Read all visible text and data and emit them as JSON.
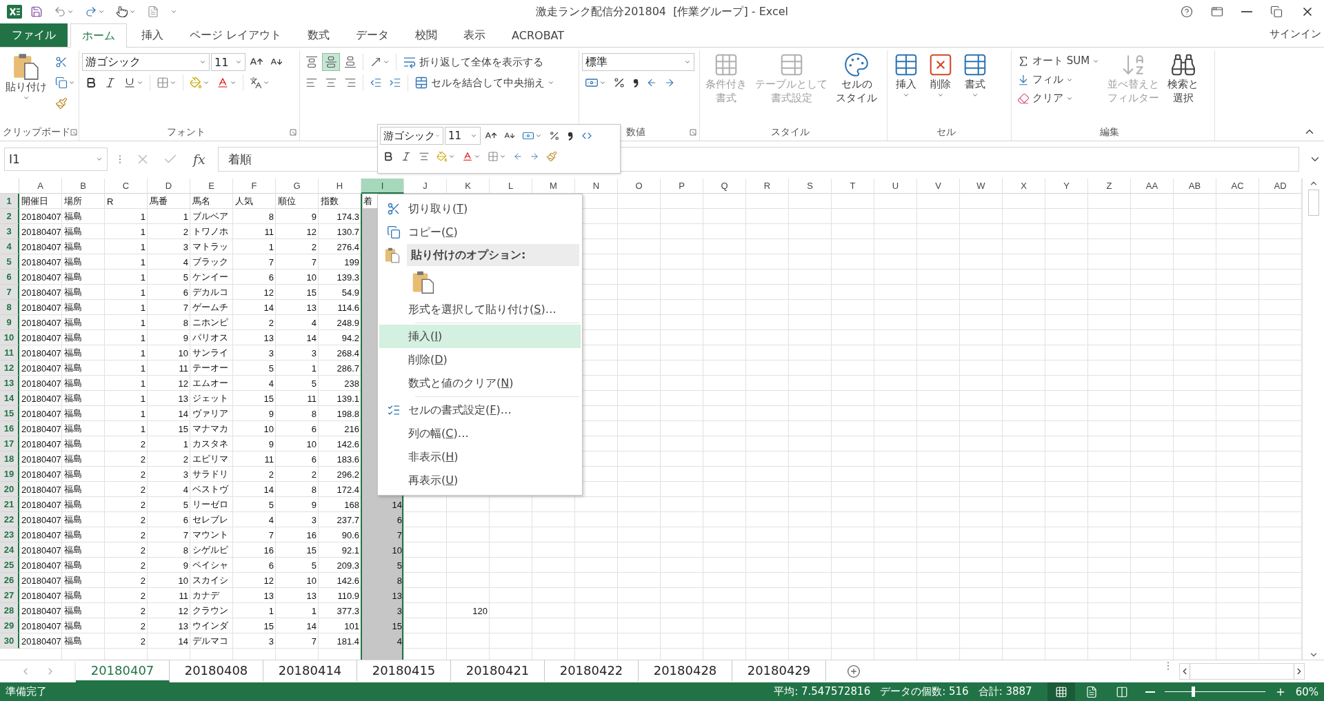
{
  "title_bar": {
    "title": "激走ランク配信分201804  [作業グループ] - Excel"
  },
  "ribbon_tabs": [
    {
      "label": "ファイル",
      "kind": "file",
      "selected": false
    },
    {
      "label": "ホーム",
      "kind": "tab",
      "selected": true
    },
    {
      "label": "挿入",
      "kind": "tab",
      "selected": false
    },
    {
      "label": "ページ レイアウト",
      "kind": "tab",
      "selected": false
    },
    {
      "label": "数式",
      "kind": "tab",
      "selected": false
    },
    {
      "label": "データ",
      "kind": "tab",
      "selected": false
    },
    {
      "label": "校閲",
      "kind": "tab",
      "selected": false
    },
    {
      "label": "表示",
      "kind": "tab",
      "selected": false
    },
    {
      "label": "ACROBAT",
      "kind": "tab",
      "selected": false
    }
  ],
  "sign_in": "サインイン",
  "ribbon": {
    "clipboard": {
      "paste": "貼り付け",
      "label": "クリップボード"
    },
    "font": {
      "face": "游ゴシック",
      "size": "11",
      "label": "フォント"
    },
    "alignment": {
      "vertical": [
        {
          "selected": false
        },
        {
          "selected": true
        },
        {
          "selected": false
        }
      ],
      "wrap": "折り返して全体を表示する",
      "merge": "セルを結合して中央揃え"
    },
    "number": {
      "format": "標準",
      "label": "数値"
    },
    "styles": {
      "buttons": [
        {
          "lines": [
            "条件付き",
            "書式"
          ],
          "disabled": true
        },
        {
          "lines": [
            "テーブルとして",
            "書式設定"
          ],
          "disabled": true
        },
        {
          "lines": [
            "セルの",
            "スタイル"
          ],
          "disabled": false
        }
      ],
      "label": "スタイル"
    },
    "cells": {
      "buttons": [
        {
          "label": "挿入"
        },
        {
          "label": "削除"
        },
        {
          "label": "書式"
        }
      ],
      "label": "セル"
    },
    "editing": {
      "autosum": "オート SUM",
      "fill": "フィル",
      "clear": "クリア",
      "buttons": [
        {
          "lines": [
            "並べ替えと",
            "フィルター"
          ],
          "disabled": true
        },
        {
          "lines": [
            "検索と",
            "選択"
          ],
          "disabled": false
        }
      ],
      "label": "編集"
    }
  },
  "formula_bar": {
    "name_box": "I1",
    "function_label": "fx",
    "value": "着順"
  },
  "mini_toolbar": {
    "font": "游ゴシック",
    "size": "11"
  },
  "columns": [
    {
      "label": "A",
      "kind": "text",
      "selected": false
    },
    {
      "label": "B",
      "kind": "text",
      "selected": false
    },
    {
      "label": "C",
      "kind": "number",
      "selected": false
    },
    {
      "label": "D",
      "kind": "number",
      "selected": false
    },
    {
      "label": "E",
      "kind": "text",
      "selected": false
    },
    {
      "label": "F",
      "kind": "number",
      "selected": false
    },
    {
      "label": "G",
      "kind": "number",
      "selected": false
    },
    {
      "label": "H",
      "kind": "number",
      "selected": false
    },
    {
      "label": "I",
      "kind": "number",
      "selected": true
    },
    {
      "label": "J",
      "kind": "number",
      "selected": false
    },
    {
      "label": "K",
      "kind": "number",
      "selected": false
    },
    {
      "label": "L",
      "kind": "number",
      "selected": false
    },
    {
      "label": "M",
      "kind": "number",
      "selected": false
    },
    {
      "label": "N",
      "kind": "number",
      "selected": false
    },
    {
      "label": "O",
      "kind": "number",
      "selected": false
    },
    {
      "label": "P",
      "kind": "number",
      "selected": false
    },
    {
      "label": "Q",
      "kind": "number",
      "selected": false
    },
    {
      "label": "R",
      "kind": "number",
      "selected": false
    },
    {
      "label": "S",
      "kind": "number",
      "selected": false
    },
    {
      "label": "T",
      "kind": "number",
      "selected": false
    },
    {
      "label": "U",
      "kind": "number",
      "selected": false
    },
    {
      "label": "V",
      "kind": "number",
      "selected": false
    },
    {
      "label": "W",
      "kind": "number",
      "selected": false
    },
    {
      "label": "X",
      "kind": "number",
      "selected": false
    },
    {
      "label": "Y",
      "kind": "number",
      "selected": false
    },
    {
      "label": "Z",
      "kind": "number",
      "selected": false
    },
    {
      "label": "AA",
      "kind": "number",
      "selected": false
    },
    {
      "label": "AB",
      "kind": "number",
      "selected": false
    },
    {
      "label": "AC",
      "kind": "number",
      "selected": false
    },
    {
      "label": "AD",
      "kind": "number",
      "selected": false
    }
  ],
  "rows": [
    {
      "number": "1",
      "kind": "header",
      "cells": [
        "開催日",
        "場所",
        "R",
        "馬番",
        "馬名",
        "人気",
        "順位",
        "指数",
        "着"
      ]
    },
    {
      "number": "2",
      "kind": "data",
      "cells": [
        "20180407",
        "福島",
        "1",
        "1",
        "ブルベア",
        "8",
        "9",
        "174.3"
      ]
    },
    {
      "number": "3",
      "kind": "data",
      "cells": [
        "20180407",
        "福島",
        "1",
        "2",
        "トワノホ",
        "11",
        "12",
        "130.7"
      ]
    },
    {
      "number": "4",
      "kind": "data",
      "cells": [
        "20180407",
        "福島",
        "1",
        "3",
        "マトラッ",
        "1",
        "2",
        "276.4"
      ]
    },
    {
      "number": "5",
      "kind": "data",
      "cells": [
        "20180407",
        "福島",
        "1",
        "4",
        "ブラック",
        "7",
        "7",
        "199"
      ]
    },
    {
      "number": "6",
      "kind": "data",
      "cells": [
        "20180407",
        "福島",
        "1",
        "5",
        "ケンイー",
        "6",
        "10",
        "139.3"
      ]
    },
    {
      "number": "7",
      "kind": "data",
      "cells": [
        "20180407",
        "福島",
        "1",
        "6",
        "デカルコ",
        "12",
        "15",
        "54.9"
      ]
    },
    {
      "number": "8",
      "kind": "data",
      "cells": [
        "20180407",
        "福島",
        "1",
        "7",
        "ゲームチ",
        "14",
        "13",
        "114.6"
      ]
    },
    {
      "number": "9",
      "kind": "data",
      "cells": [
        "20180407",
        "福島",
        "1",
        "8",
        "ニホンピ",
        "2",
        "4",
        "248.9"
      ]
    },
    {
      "number": "10",
      "kind": "data",
      "cells": [
        "20180407",
        "福島",
        "1",
        "9",
        "パリオス",
        "13",
        "14",
        "94.2"
      ]
    },
    {
      "number": "11",
      "kind": "data",
      "cells": [
        "20180407",
        "福島",
        "1",
        "10",
        "サンライ",
        "3",
        "3",
        "268.4"
      ]
    },
    {
      "number": "12",
      "kind": "data",
      "cells": [
        "20180407",
        "福島",
        "1",
        "11",
        "テーオー",
        "5",
        "1",
        "286.7"
      ]
    },
    {
      "number": "13",
      "kind": "data",
      "cells": [
        "20180407",
        "福島",
        "1",
        "12",
        "エムオー",
        "4",
        "5",
        "238"
      ]
    },
    {
      "number": "14",
      "kind": "data",
      "cells": [
        "20180407",
        "福島",
        "1",
        "13",
        "ジェット",
        "15",
        "11",
        "139.1"
      ]
    },
    {
      "number": "15",
      "kind": "data",
      "cells": [
        "20180407",
        "福島",
        "1",
        "14",
        "ヴァリア",
        "9",
        "8",
        "198.8"
      ]
    },
    {
      "number": "16",
      "kind": "data",
      "cells": [
        "20180407",
        "福島",
        "1",
        "15",
        "マナマカ",
        "10",
        "6",
        "216"
      ]
    },
    {
      "number": "17",
      "kind": "data",
      "cells": [
        "20180407",
        "福島",
        "2",
        "1",
        "カスタネ",
        "9",
        "10",
        "142.6"
      ]
    },
    {
      "number": "18",
      "kind": "data",
      "cells": [
        "20180407",
        "福島",
        "2",
        "2",
        "エピリマ",
        "11",
        "6",
        "183.6"
      ]
    },
    {
      "number": "19",
      "kind": "data",
      "cells": [
        "20180407",
        "福島",
        "2",
        "3",
        "サラドリ",
        "2",
        "2",
        "296.2"
      ]
    },
    {
      "number": "20",
      "kind": "data",
      "cells": [
        "20180407",
        "福島",
        "2",
        "4",
        "ベストヴ",
        "14",
        "8",
        "172.4"
      ]
    },
    {
      "number": "21",
      "kind": "data",
      "cells": [
        "20180407",
        "福島",
        "2",
        "5",
        "リーゼロ",
        "5",
        "9",
        "168",
        "14"
      ]
    },
    {
      "number": "22",
      "kind": "data",
      "cells": [
        "20180407",
        "福島",
        "2",
        "6",
        "セレブレ",
        "4",
        "3",
        "237.7",
        "6"
      ]
    },
    {
      "number": "23",
      "kind": "data",
      "cells": [
        "20180407",
        "福島",
        "2",
        "7",
        "マウント",
        "7",
        "16",
        "90.6",
        "7"
      ]
    },
    {
      "number": "24",
      "kind": "data",
      "cells": [
        "20180407",
        "福島",
        "2",
        "8",
        "シゲルピ",
        "16",
        "15",
        "92.1",
        "10"
      ]
    },
    {
      "number": "25",
      "kind": "data",
      "cells": [
        "20180407",
        "福島",
        "2",
        "9",
        "ペイシャ",
        "6",
        "5",
        "209.3",
        "5"
      ]
    },
    {
      "number": "26",
      "kind": "data",
      "cells": [
        "20180407",
        "福島",
        "2",
        "10",
        "スカイシ",
        "12",
        "10",
        "142.6",
        "8"
      ]
    },
    {
      "number": "27",
      "kind": "data",
      "cells": [
        "20180407",
        "福島",
        "2",
        "11",
        "カナデ",
        "13",
        "13",
        "110.9",
        "13"
      ]
    },
    {
      "number": "28",
      "kind": "data",
      "cells": [
        "20180407",
        "福島",
        "2",
        "12",
        "クラウン",
        "1",
        "1",
        "377.3",
        "3",
        null,
        "120"
      ]
    },
    {
      "number": "29",
      "kind": "data",
      "cells": [
        "20180407",
        "福島",
        "2",
        "13",
        "ウインダ",
        "15",
        "14",
        "101",
        "15"
      ]
    },
    {
      "number": "30",
      "kind": "data",
      "cells": [
        "20180407",
        "福島",
        "2",
        "14",
        "デルマコ",
        "3",
        "7",
        "181.4",
        "4"
      ]
    }
  ],
  "context_menu": {
    "items": [
      {
        "kind": "cut",
        "before": "切り取り(",
        "key": "T",
        "after": ")",
        "selected": false
      },
      {
        "kind": "copy",
        "before": "コピー(",
        "key": "C",
        "after": ")",
        "selected": false
      },
      {
        "kind": "paste-header",
        "label": "貼り付けのオプション:"
      },
      {
        "kind": "paste-option"
      },
      {
        "kind": "item",
        "before": "形式を選択して貼り付け(",
        "key": "S",
        "after": ")…",
        "selected": false
      },
      {
        "kind": "separator"
      },
      {
        "kind": "item",
        "before": "挿入(",
        "key": "I",
        "after": ")",
        "selected": true
      },
      {
        "kind": "item",
        "before": "削除(",
        "key": "D",
        "after": ")",
        "selected": false
      },
      {
        "kind": "item",
        "before": "数式と値のクリア(",
        "key": "N",
        "after": ")",
        "selected": false
      },
      {
        "kind": "separator"
      },
      {
        "kind": "format",
        "before": "セルの書式設定(",
        "key": "F",
        "after": ")…",
        "selected": false
      },
      {
        "kind": "item",
        "before": "列の幅(",
        "key": "C",
        "after": ")…",
        "selected": false
      },
      {
        "kind": "item",
        "before": "非表示(",
        "key": "H",
        "after": ")",
        "selected": false
      },
      {
        "kind": "item",
        "before": "再表示(",
        "key": "U",
        "after": ")",
        "selected": false
      }
    ]
  },
  "sheet_tabs": [
    {
      "label": "20180407",
      "selected": true
    },
    {
      "label": "20180408",
      "selected": false
    },
    {
      "label": "20180414",
      "selected": false
    },
    {
      "label": "20180415",
      "selected": false
    },
    {
      "label": "20180421",
      "selected": false
    },
    {
      "label": "20180422",
      "selected": false
    },
    {
      "label": "20180428",
      "selected": false
    },
    {
      "label": "20180429",
      "selected": false
    }
  ],
  "status_bar": {
    "ready": "準備完了",
    "average": "平均: 7.547572816",
    "count": "データの個数: 516",
    "sum": "合計: 3887",
    "views": [
      {
        "selected": true
      },
      {
        "selected": false
      },
      {
        "selected": false
      }
    ],
    "zoom": {
      "level": 0.28,
      "label": "60%"
    }
  }
}
